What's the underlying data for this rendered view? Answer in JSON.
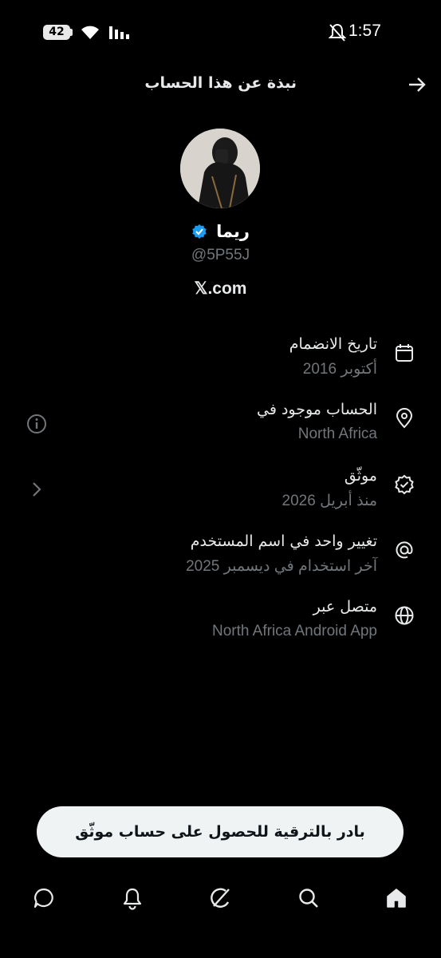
{
  "status_bar": {
    "battery": "42",
    "time": "1:57"
  },
  "header": {
    "title": "نبذة عن هذا الحساب"
  },
  "profile": {
    "name": "ريما",
    "handle": "@5P55J",
    "website": "𝕏.com"
  },
  "info_items": [
    {
      "icon": "calendar-icon",
      "title": "تاريخ الانضمام",
      "subtitle": "أكتوبر 2016"
    },
    {
      "icon": "location-pin-icon",
      "title": "الحساب موجود في",
      "subtitle": "North Africa"
    },
    {
      "icon": "verified-badge-icon",
      "title": "موثّق",
      "subtitle": "منذ أبريل 2026"
    },
    {
      "icon": "at-sign-icon",
      "title": "تغيير واحد في اسم المستخدم",
      "subtitle": "آخر استخدام في ديسمبر 2025"
    },
    {
      "icon": "globe-icon",
      "title": "متصل عبر",
      "subtitle": "North Africa Android App"
    }
  ],
  "upgrade_button": {
    "label": "بادر بالترقية للحصول على حساب موثّق"
  },
  "bottom_nav": [
    "chat-icon",
    "bell-icon",
    "grok-icon",
    "search-icon",
    "home-icon"
  ],
  "colors": {
    "background": "#000000",
    "text": "#e7e9ea",
    "secondary": "#71767b",
    "verified": "#1d9bf0"
  }
}
